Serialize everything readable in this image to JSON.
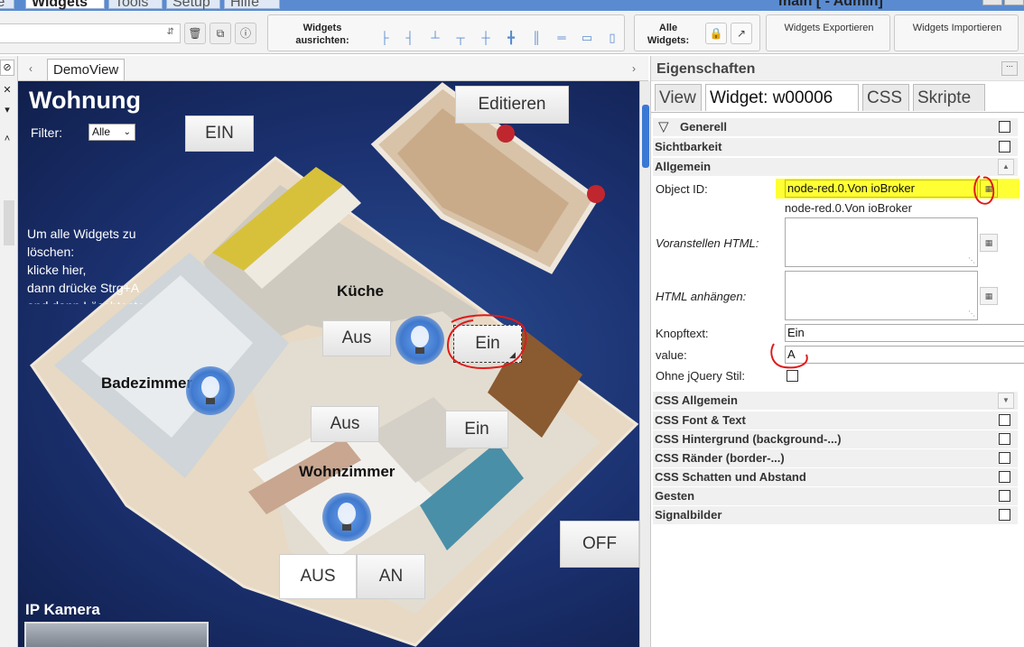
{
  "menubar": {
    "tabs": [
      "ie",
      "Widgets",
      "Tools",
      "Setup",
      "Hilfe"
    ],
    "active_tab": "Widgets",
    "title": "main [ - Admin]"
  },
  "toolbar": {
    "align_label": "Widgets ausrichten:",
    "all_label": "Alle Widgets:",
    "export_label": "Widgets Exportieren",
    "import_label": "Widgets Importieren"
  },
  "editor": {
    "view_tab": "DemoView"
  },
  "canvas": {
    "title": "Wohnung",
    "filter_label": "Filter:",
    "filter_value": "Alle",
    "ein_top": "EIN",
    "editieren": "Editieren",
    "info_lines": [
      "Um alle Widgets zu",
      "löschen:",
      "klicke hier,",
      "dann drücke Strg+A",
      "and dann Löschtaste"
    ],
    "kueche": "Küche",
    "badezimmer": "Badezimmer",
    "wohnzimmer": "Wohnzimmer",
    "aus_kueche": "Aus",
    "ein_kueche": "Ein",
    "aus_wohn": "Aus",
    "ein_wohn": "Ein",
    "off": "OFF",
    "aus_bottom": "AUS",
    "an_bottom": "AN",
    "ip_kamera": "IP Kamera"
  },
  "props": {
    "header": "Eigenschaften",
    "tabs": [
      "View",
      "Widget: w00006",
      "CSS",
      "Skripte"
    ],
    "sections": {
      "generell": "Generell",
      "sichtbarkeit": "Sichtbarkeit",
      "allgemein": "Allgemein",
      "css_allgemein": "CSS Allgemein",
      "css_font": "CSS Font & Text",
      "css_bg": "CSS Hintergrund (background-...)",
      "css_border": "CSS Ränder (border-...)",
      "css_shadow": "CSS Schatten und Abstand",
      "gesten": "Gesten",
      "signal": "Signalbilder"
    },
    "fields": {
      "object_id_label": "Object ID:",
      "object_id_value": "node-red.0.Von ioBroker",
      "object_id_hint": "node-red.0.Von ioBroker",
      "prepend_label": "Voranstellen HTML:",
      "append_label": "HTML anhängen:",
      "button_text_label": "Knopftext:",
      "button_text_value": "Ein",
      "value_label": "value:",
      "value_value": "A",
      "no_jquery_label": "Ohne jQuery Stil:"
    },
    "colors": {
      "highlight": "#ffff33",
      "annotation": "#e0191a"
    }
  }
}
